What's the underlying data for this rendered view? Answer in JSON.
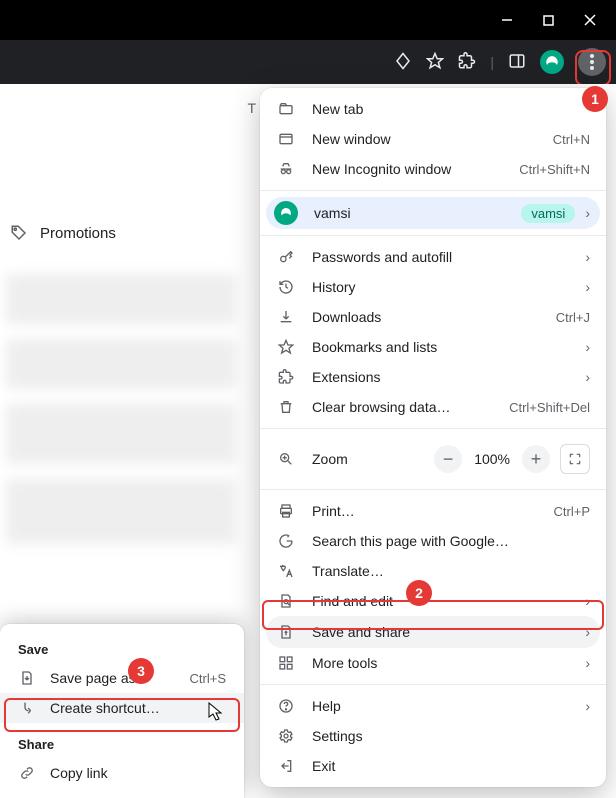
{
  "window": {
    "t_letter": "T"
  },
  "page": {
    "promotions": "Promotions"
  },
  "account": {
    "name": "vamsi",
    "chip": "vamsi"
  },
  "menu": {
    "new_tab": "New tab",
    "new_window": "New window",
    "new_window_sc": "Ctrl+N",
    "incognito": "New Incognito window",
    "incognito_sc": "Ctrl+Shift+N",
    "passwords": "Passwords and autofill",
    "history": "History",
    "downloads": "Downloads",
    "downloads_sc": "Ctrl+J",
    "bookmarks": "Bookmarks and lists",
    "extensions": "Extensions",
    "clear": "Clear browsing data…",
    "clear_sc": "Ctrl+Shift+Del",
    "zoom": "Zoom",
    "zoom_val": "100%",
    "print": "Print…",
    "print_sc": "Ctrl+P",
    "search_google": "Search this page with Google…",
    "translate": "Translate…",
    "find": "Find and edit",
    "save_share": "Save and share",
    "more_tools": "More tools",
    "help": "Help",
    "settings": "Settings",
    "exit": "Exit"
  },
  "submenu": {
    "save_header": "Save",
    "save_page": "Save page as",
    "save_page_sc": "Ctrl+S",
    "create_shortcut": "Create shortcut…",
    "share_header": "Share",
    "copy_link": "Copy link"
  },
  "annot": {
    "n1": "1",
    "n2": "2",
    "n3": "3"
  }
}
